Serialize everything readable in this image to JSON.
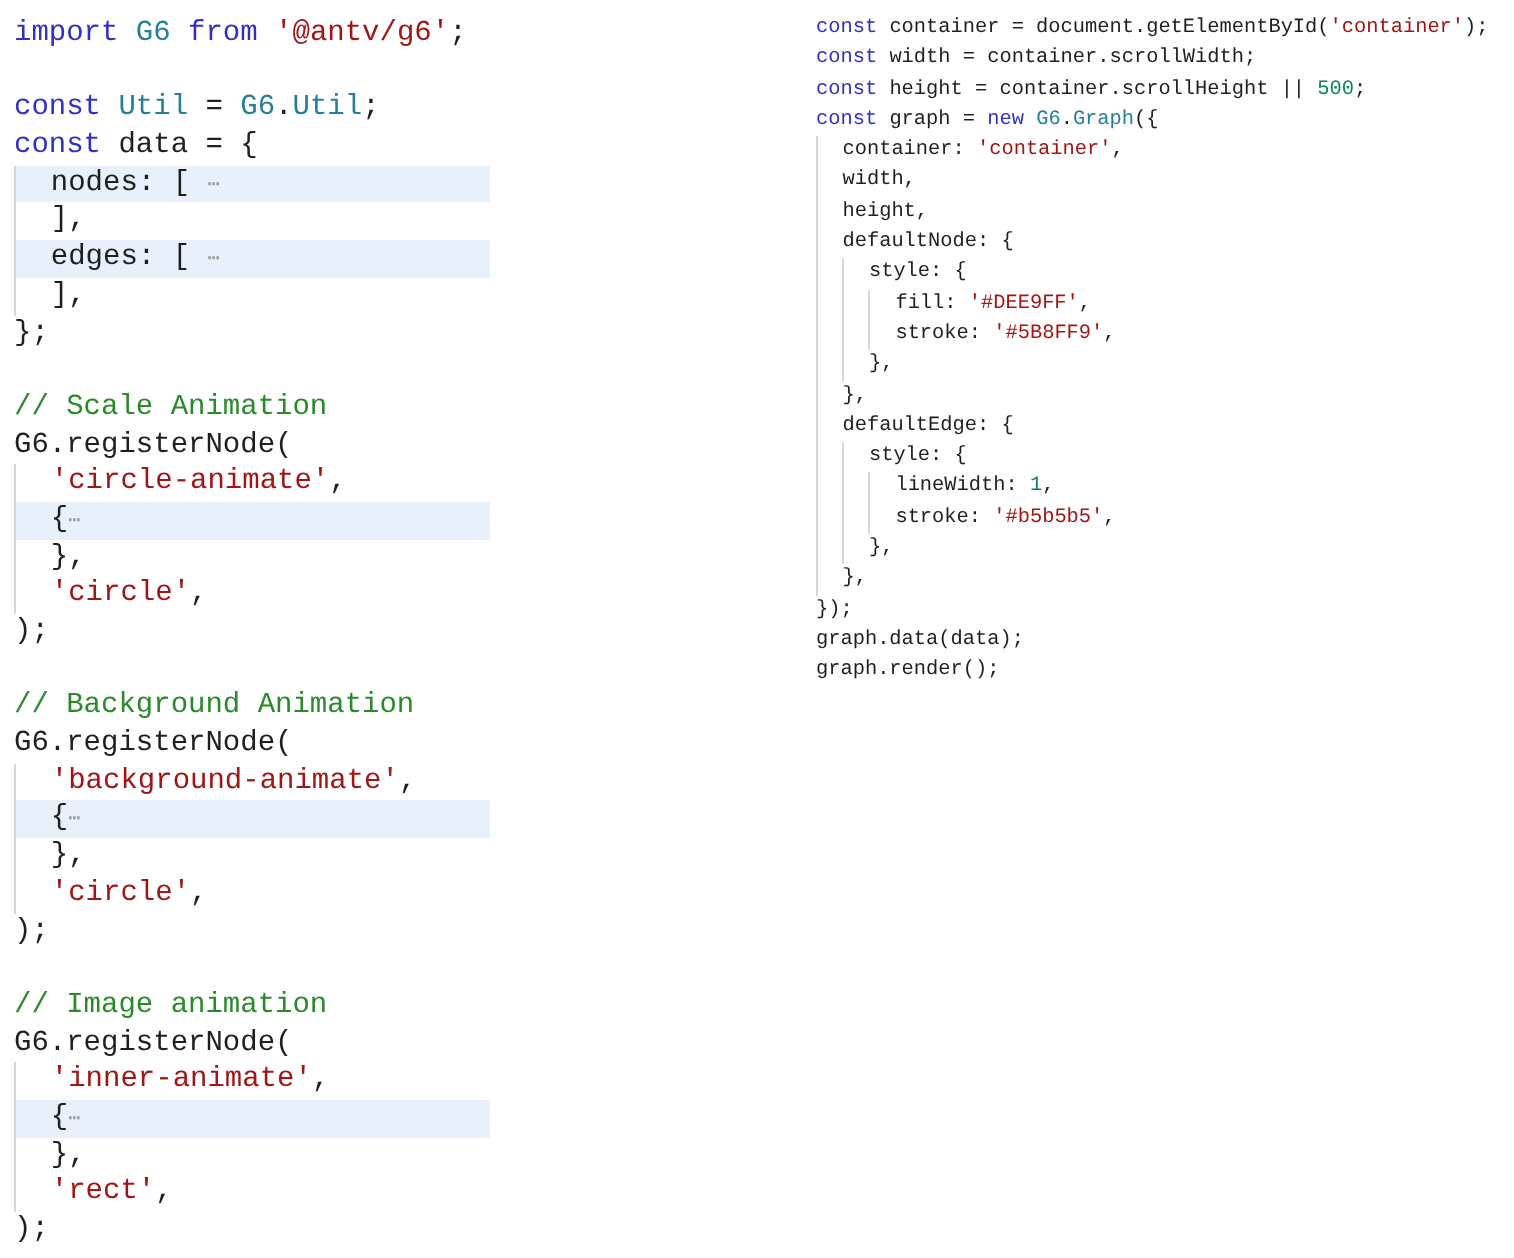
{
  "left_code": {
    "lines": [
      {
        "kind": "code",
        "tokens": [
          {
            "kind": "keyword",
            "text": "import "
          },
          {
            "kind": "type",
            "text": "G6 "
          },
          {
            "kind": "keyword",
            "text": "from "
          },
          {
            "kind": "string",
            "text": "'@antv/g6'"
          },
          {
            "kind": "plain",
            "text": ";"
          }
        ]
      },
      {
        "kind": "blank"
      },
      {
        "kind": "code",
        "tokens": [
          {
            "kind": "keyword",
            "text": "const "
          },
          {
            "kind": "type",
            "text": "Util"
          },
          {
            "kind": "plain",
            "text": " = "
          },
          {
            "kind": "type",
            "text": "G6"
          },
          {
            "kind": "plain",
            "text": "."
          },
          {
            "kind": "type",
            "text": "Util"
          },
          {
            "kind": "plain",
            "text": ";"
          }
        ]
      },
      {
        "kind": "code",
        "tokens": [
          {
            "kind": "keyword",
            "text": "const"
          },
          {
            "kind": "plain",
            "text": " data = {"
          }
        ]
      },
      {
        "kind": "folded",
        "tokens": [
          {
            "kind": "plain",
            "text": "  nodes: [ "
          },
          {
            "kind": "fold",
            "text": "⋯"
          }
        ]
      },
      {
        "kind": "code",
        "tokens": [
          {
            "kind": "plain",
            "text": "  ],"
          }
        ]
      },
      {
        "kind": "folded",
        "tokens": [
          {
            "kind": "plain",
            "text": "  edges: [ "
          },
          {
            "kind": "fold",
            "text": "⋯"
          }
        ]
      },
      {
        "kind": "code",
        "tokens": [
          {
            "kind": "plain",
            "text": "  ],"
          }
        ]
      },
      {
        "kind": "code",
        "tokens": [
          {
            "kind": "plain",
            "text": "};"
          }
        ]
      },
      {
        "kind": "blank"
      },
      {
        "kind": "code",
        "tokens": [
          {
            "kind": "comment",
            "text": "// Scale Animation"
          }
        ]
      },
      {
        "kind": "code",
        "tokens": [
          {
            "kind": "plain",
            "text": "G6.registerNode("
          }
        ]
      },
      {
        "kind": "code",
        "tokens": [
          {
            "kind": "string",
            "text": "  'circle-animate'"
          },
          {
            "kind": "plain",
            "text": ","
          }
        ]
      },
      {
        "kind": "folded",
        "tokens": [
          {
            "kind": "plain",
            "text": "  {"
          },
          {
            "kind": "fold",
            "text": "⋯"
          }
        ]
      },
      {
        "kind": "code",
        "tokens": [
          {
            "kind": "plain",
            "text": "  },"
          }
        ]
      },
      {
        "kind": "code",
        "tokens": [
          {
            "kind": "string",
            "text": "  'circle'"
          },
          {
            "kind": "plain",
            "text": ","
          }
        ]
      },
      {
        "kind": "code",
        "tokens": [
          {
            "kind": "plain",
            "text": ");"
          }
        ]
      },
      {
        "kind": "blank"
      },
      {
        "kind": "code",
        "tokens": [
          {
            "kind": "comment",
            "text": "// Background Animation"
          }
        ]
      },
      {
        "kind": "code",
        "tokens": [
          {
            "kind": "plain",
            "text": "G6.registerNode("
          }
        ]
      },
      {
        "kind": "code",
        "tokens": [
          {
            "kind": "string",
            "text": "  'background-animate'"
          },
          {
            "kind": "plain",
            "text": ","
          }
        ]
      },
      {
        "kind": "folded",
        "tokens": [
          {
            "kind": "plain",
            "text": "  {"
          },
          {
            "kind": "fold",
            "text": "⋯"
          }
        ]
      },
      {
        "kind": "code",
        "tokens": [
          {
            "kind": "plain",
            "text": "  },"
          }
        ]
      },
      {
        "kind": "code",
        "tokens": [
          {
            "kind": "string",
            "text": "  'circle'"
          },
          {
            "kind": "plain",
            "text": ","
          }
        ]
      },
      {
        "kind": "code",
        "tokens": [
          {
            "kind": "plain",
            "text": ");"
          }
        ]
      },
      {
        "kind": "blank"
      },
      {
        "kind": "code",
        "tokens": [
          {
            "kind": "comment",
            "text": "// Image animation"
          }
        ]
      },
      {
        "kind": "code",
        "tokens": [
          {
            "kind": "plain",
            "text": "G6.registerNode("
          }
        ]
      },
      {
        "kind": "code",
        "tokens": [
          {
            "kind": "string",
            "text": "  'inner-animate'"
          },
          {
            "kind": "plain",
            "text": ","
          }
        ]
      },
      {
        "kind": "folded",
        "tokens": [
          {
            "kind": "plain",
            "text": "  {"
          },
          {
            "kind": "fold",
            "text": "⋯"
          }
        ]
      },
      {
        "kind": "code",
        "tokens": [
          {
            "kind": "plain",
            "text": "  },"
          }
        ]
      },
      {
        "kind": "code",
        "tokens": [
          {
            "kind": "string",
            "text": "  'rect'"
          },
          {
            "kind": "plain",
            "text": ","
          }
        ]
      },
      {
        "kind": "code",
        "tokens": [
          {
            "kind": "plain",
            "text": ");"
          }
        ]
      }
    ]
  },
  "right_code": {
    "lines": [
      {
        "kind": "code",
        "tokens": [
          {
            "kind": "keyword",
            "text": "const"
          },
          {
            "kind": "plain",
            "text": " container = document.getElementById("
          },
          {
            "kind": "string",
            "text": "'container'"
          },
          {
            "kind": "plain",
            "text": ");"
          }
        ]
      },
      {
        "kind": "code",
        "tokens": [
          {
            "kind": "keyword",
            "text": "const"
          },
          {
            "kind": "plain",
            "text": " width = container.scrollWidth;"
          }
        ]
      },
      {
        "kind": "code",
        "tokens": [
          {
            "kind": "keyword",
            "text": "const"
          },
          {
            "kind": "plain",
            "text": " height = container.scrollHeight || "
          },
          {
            "kind": "number",
            "text": "500"
          },
          {
            "kind": "plain",
            "text": ";"
          }
        ]
      },
      {
        "kind": "code",
        "tokens": [
          {
            "kind": "keyword",
            "text": "const"
          },
          {
            "kind": "plain",
            "text": " graph = "
          },
          {
            "kind": "keyword",
            "text": "new "
          },
          {
            "kind": "type",
            "text": "G6"
          },
          {
            "kind": "plain",
            "text": "."
          },
          {
            "kind": "type",
            "text": "Graph"
          },
          {
            "kind": "plain",
            "text": "({"
          }
        ]
      },
      {
        "kind": "code",
        "tokens": [
          {
            "kind": "plain",
            "text": "  container: "
          },
          {
            "kind": "string",
            "text": "'container'"
          },
          {
            "kind": "plain",
            "text": ","
          }
        ]
      },
      {
        "kind": "code",
        "tokens": [
          {
            "kind": "plain",
            "text": "  width,"
          }
        ]
      },
      {
        "kind": "code",
        "tokens": [
          {
            "kind": "plain",
            "text": "  height,"
          }
        ]
      },
      {
        "kind": "code",
        "tokens": [
          {
            "kind": "plain",
            "text": "  defaultNode: {"
          }
        ]
      },
      {
        "kind": "code",
        "tokens": [
          {
            "kind": "plain",
            "text": "    style: {"
          }
        ]
      },
      {
        "kind": "code",
        "tokens": [
          {
            "kind": "plain",
            "text": "      fill: "
          },
          {
            "kind": "string",
            "text": "'#DEE9FF'"
          },
          {
            "kind": "plain",
            "text": ","
          }
        ]
      },
      {
        "kind": "code",
        "tokens": [
          {
            "kind": "plain",
            "text": "      stroke: "
          },
          {
            "kind": "string",
            "text": "'#5B8FF9'"
          },
          {
            "kind": "plain",
            "text": ","
          }
        ]
      },
      {
        "kind": "code",
        "tokens": [
          {
            "kind": "plain",
            "text": "    },"
          }
        ]
      },
      {
        "kind": "code",
        "tokens": [
          {
            "kind": "plain",
            "text": "  },"
          }
        ]
      },
      {
        "kind": "code",
        "tokens": [
          {
            "kind": "plain",
            "text": "  defaultEdge: {"
          }
        ]
      },
      {
        "kind": "code",
        "tokens": [
          {
            "kind": "plain",
            "text": "    style: {"
          }
        ]
      },
      {
        "kind": "code",
        "tokens": [
          {
            "kind": "plain",
            "text": "      lineWidth: "
          },
          {
            "kind": "number",
            "text": "1"
          },
          {
            "kind": "plain",
            "text": ","
          }
        ]
      },
      {
        "kind": "code",
        "tokens": [
          {
            "kind": "plain",
            "text": "      stroke: "
          },
          {
            "kind": "string",
            "text": "'#b5b5b5'"
          },
          {
            "kind": "plain",
            "text": ","
          }
        ]
      },
      {
        "kind": "code",
        "tokens": [
          {
            "kind": "plain",
            "text": "    },"
          }
        ]
      },
      {
        "kind": "code",
        "tokens": [
          {
            "kind": "plain",
            "text": "  },"
          }
        ]
      },
      {
        "kind": "code",
        "tokens": [
          {
            "kind": "plain",
            "text": "});"
          }
        ]
      },
      {
        "kind": "code",
        "tokens": [
          {
            "kind": "plain",
            "text": "graph.data(data);"
          }
        ]
      },
      {
        "kind": "code",
        "tokens": [
          {
            "kind": "plain",
            "text": "graph.render();"
          }
        ]
      }
    ]
  }
}
